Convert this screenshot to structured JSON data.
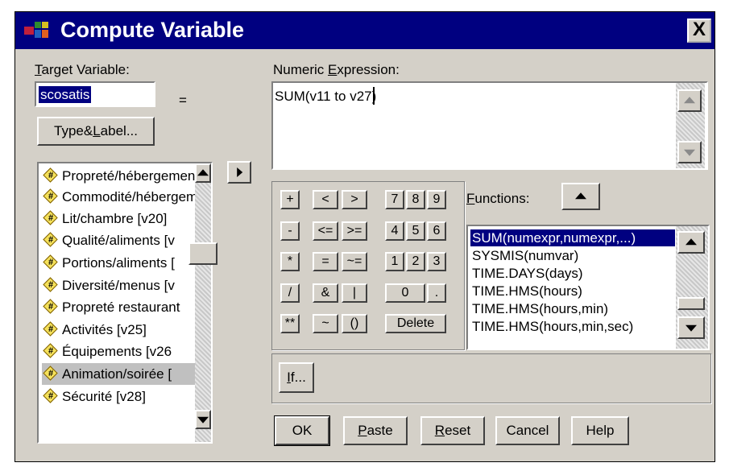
{
  "dialog": {
    "title": "Compute Variable",
    "close_glyph": "X"
  },
  "target": {
    "label": "Target Variable:",
    "value": "scosatis",
    "equals": "=",
    "type_label_button": "Type&Label..."
  },
  "variables": [
    {
      "label": "Propreté/hébergement"
    },
    {
      "label": "Commodité/hébergement"
    },
    {
      "label": "Lit/chambre [v20]"
    },
    {
      "label": "Qualité/aliments [v"
    },
    {
      "label": "Portions/aliments ["
    },
    {
      "label": "Diversité/menus [v"
    },
    {
      "label": "Propreté restaurant"
    },
    {
      "label": "Activités [v25]"
    },
    {
      "label": "Équipements [v26"
    },
    {
      "label": "Animation/soirée ["
    },
    {
      "label": "Sécurité [v28]"
    }
  ],
  "expression": {
    "label": "Numeric Expression:",
    "value": "SUM(v11 to v27)"
  },
  "keypad": {
    "plus": "+",
    "lt": "<",
    "gt": ">",
    "minus": "-",
    "le": "<=",
    "ge": ">=",
    "times": "*",
    "eq": "=",
    "ne": "~=",
    "divide": "/",
    "and": "&",
    "or": "|",
    "power": "**",
    "not": "~",
    "parens": "()",
    "d7": "7",
    "d8": "8",
    "d9": "9",
    "d4": "4",
    "d5": "5",
    "d6": "6",
    "d1": "1",
    "d2": "2",
    "d3": "3",
    "d0": "0",
    "dot": ".",
    "delete": "Delete"
  },
  "functions": {
    "label": "Functions:",
    "items": [
      "SUM(numexpr,numexpr,...)",
      "SYSMIS(numvar)",
      "TIME.DAYS(days)",
      "TIME.HMS(hours)",
      "TIME.HMS(hours,min)",
      "TIME.HMS(hours,min,sec)"
    ],
    "selected_index": 0
  },
  "buttons": {
    "if": "If...",
    "ok": "OK",
    "paste": "Paste",
    "reset": "Reset",
    "cancel": "Cancel",
    "help": "Help"
  },
  "colors": {
    "title_bar": "#000080",
    "dialog_bg": "#d4d0c8",
    "selection": "#000080"
  }
}
